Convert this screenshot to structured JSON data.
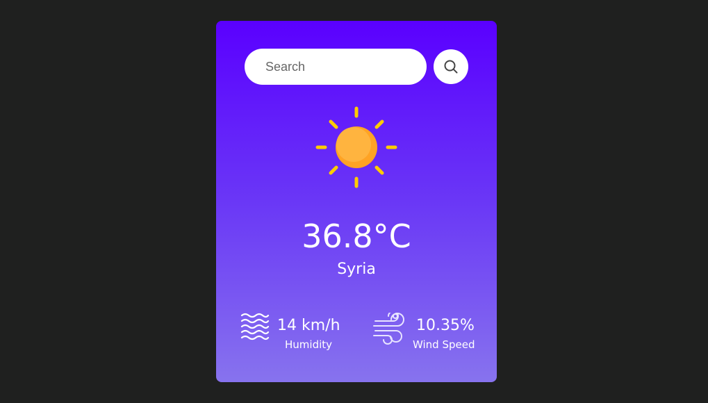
{
  "search": {
    "placeholder": "Search",
    "button_icon": "search-icon"
  },
  "weather": {
    "icon": "sun-icon",
    "temperature": "36.8°C",
    "city": "Syria"
  },
  "details": {
    "humidity": {
      "icon": "waves-icon",
      "value": "14 km/h",
      "label": "Humidity"
    },
    "wind": {
      "icon": "wind-icon",
      "value": "10.35%",
      "label": "Wind Speed"
    }
  },
  "colors": {
    "page_background": "#1f201f",
    "card_gradient_top": "#5a00ff",
    "card_gradient_bottom": "#8773ee",
    "sun_rays": "#ffcc00",
    "sun_body": "#ffaa33"
  }
}
